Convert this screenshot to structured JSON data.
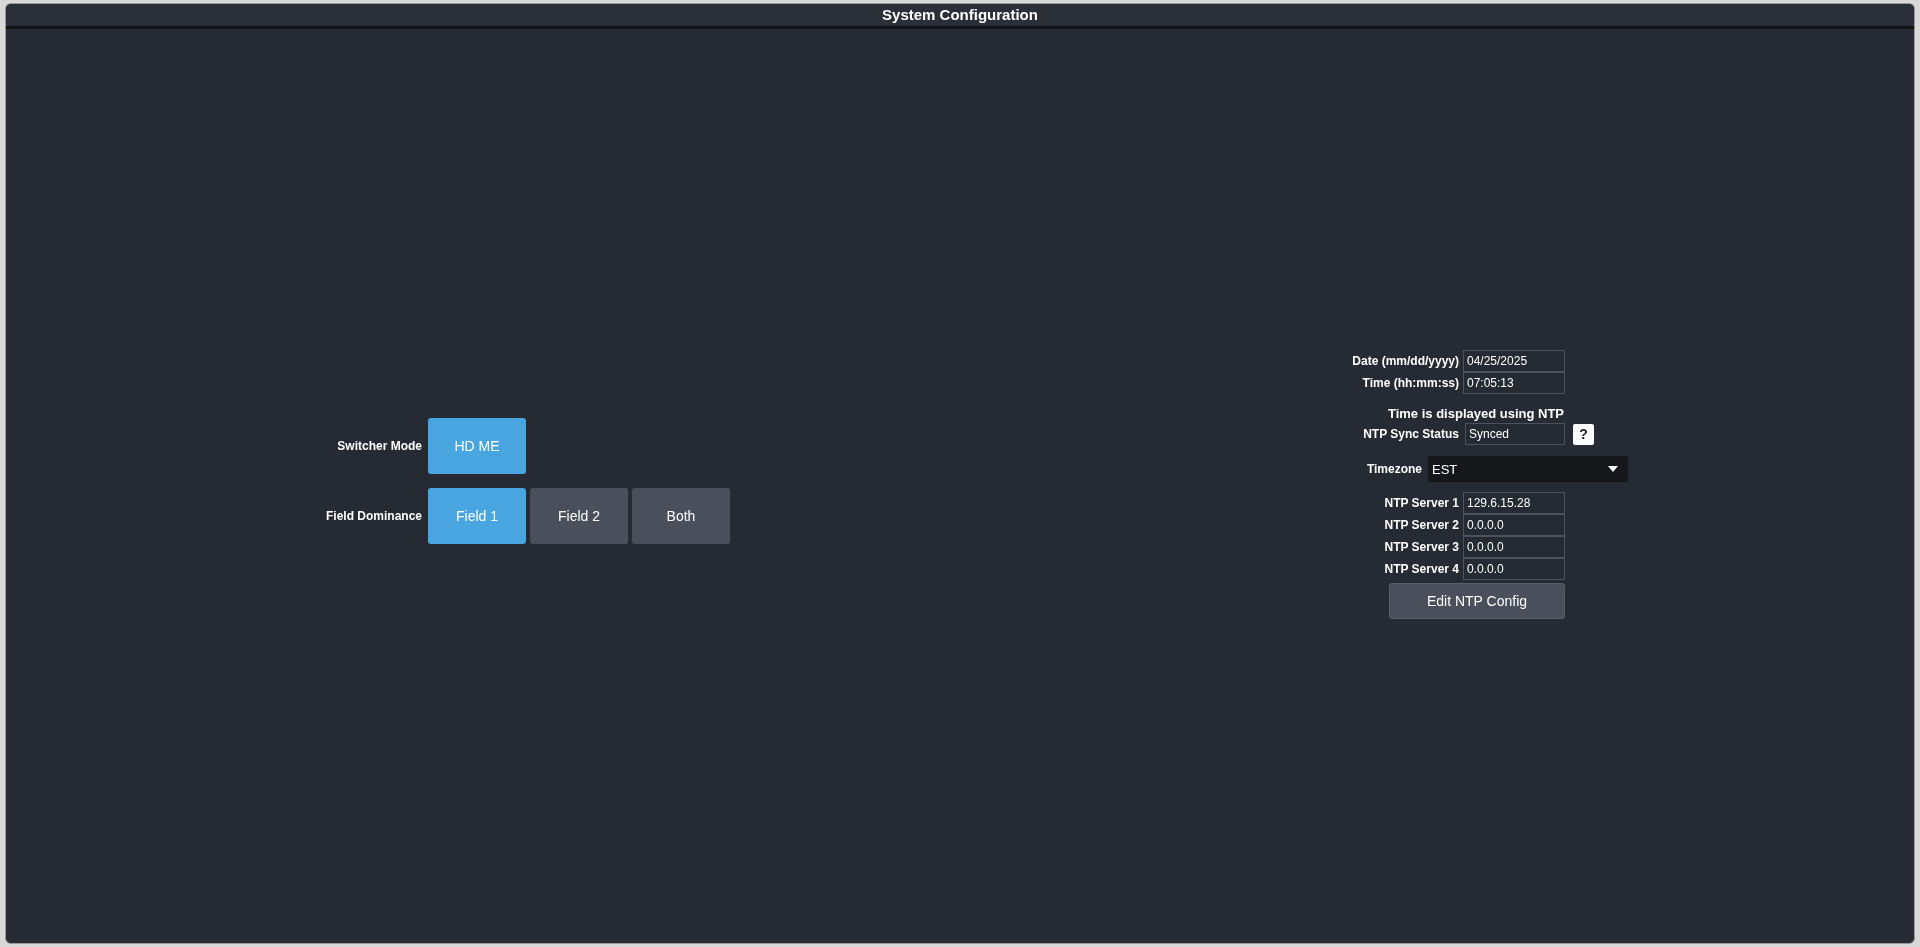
{
  "window": {
    "title": "System Configuration"
  },
  "button_groups": [
    {
      "label": "Switcher Mode",
      "options": [
        {
          "label": "HD ME",
          "selected": true
        }
      ]
    },
    {
      "label": "Field Dominance",
      "options": [
        {
          "label": "Field 1",
          "selected": true
        },
        {
          "label": "Field 2",
          "selected": false
        },
        {
          "label": "Both",
          "selected": false
        }
      ]
    }
  ],
  "clock": {
    "fields": [
      {
        "label": "Date (mm/dd/yyyy)",
        "value": "04/25/2025"
      },
      {
        "label": "Time (hh:mm:ss)",
        "value": "07:05:13"
      }
    ],
    "note": "Time is displayed using NTP",
    "sync_status": {
      "label": "NTP Sync Status",
      "value": "Synced",
      "help": "?"
    },
    "timezone": {
      "label": "Timezone",
      "value": "EST"
    },
    "servers": [
      {
        "label": "NTP Server 1",
        "value": "129.6.15.28"
      },
      {
        "label": "NTP Server 2",
        "value": "0.0.0.0"
      },
      {
        "label": "NTP Server 3",
        "value": "0.0.0.0"
      },
      {
        "label": "NTP Server 4",
        "value": "0.0.0.0"
      }
    ],
    "edit_button": "Edit NTP Config"
  }
}
